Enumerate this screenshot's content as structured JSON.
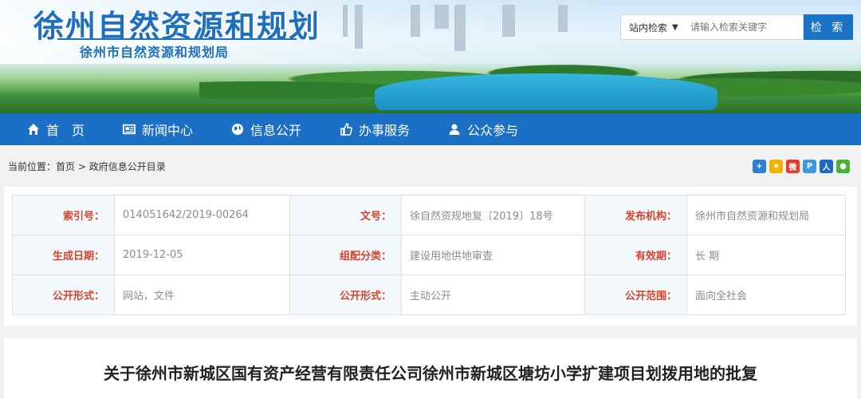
{
  "header": {
    "title": "徐州自然资源和规划",
    "subtitle": "徐州市自然资源和规划局"
  },
  "search": {
    "scope_label": "站内检索",
    "placeholder": "请输入检索关键字",
    "button_label": "检 索"
  },
  "nav": {
    "items": [
      {
        "label": "首　页",
        "icon": "home-icon"
      },
      {
        "label": "新闻中心",
        "icon": "newspaper-icon"
      },
      {
        "label": "信息公开",
        "icon": "globe-icon"
      },
      {
        "label": "办事服务",
        "icon": "thumbs-up-icon"
      },
      {
        "label": "公众参与",
        "icon": "user-icon"
      }
    ]
  },
  "breadcrumb": {
    "prefix": "当前位置：",
    "home": "首页",
    "sep": ">",
    "current": "政府信息公开目录"
  },
  "share": [
    "plus-share-icon",
    "qzone-icon",
    "weibo-icon",
    "tencent-icon",
    "renren-icon",
    "wechat-icon"
  ],
  "info": {
    "rows": [
      [
        {
          "label": "索引号：",
          "value": "014051642/2019-00264"
        },
        {
          "label": "文号：",
          "value": "徐自然资规地复〔2019〕18号"
        },
        {
          "label": "发布机构：",
          "value": "徐州市自然资源和规划局"
        }
      ],
      [
        {
          "label": "生成日期：",
          "value": "2019-12-05"
        },
        {
          "label": "组配分类：",
          "value": "建设用地供地审查"
        },
        {
          "label": "有效期：",
          "value": "长 期"
        }
      ],
      [
        {
          "label": "公开形式：",
          "value": "网站，文件"
        },
        {
          "label": "公开形式：",
          "value": "主动公开"
        },
        {
          "label": "公开范围：",
          "value": "面向全社会"
        }
      ]
    ]
  },
  "document": {
    "title": "关于徐州市新城区国有资产经营有限责任公司徐州市新城区塘坊小学扩建项目划拨用地的批复"
  },
  "colors": {
    "brand_blue": "#1b6fc4",
    "label_red": "#d9422d"
  }
}
